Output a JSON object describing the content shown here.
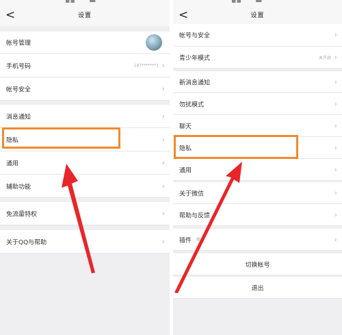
{
  "left": {
    "title": "设置",
    "back_icon": "chevron-left-icon",
    "rows": [
      {
        "label": "帐号管理",
        "trailing": "avatar"
      },
      {
        "label": "手机号码",
        "value": "187*******1"
      },
      {
        "label": "帐号安全"
      },
      {
        "label": "消息通知"
      },
      {
        "label": "隐私"
      },
      {
        "label": "通用"
      },
      {
        "label": "辅助功能"
      },
      {
        "label": "免流量特权"
      },
      {
        "label": "关于QQ与帮助"
      }
    ]
  },
  "right": {
    "title": "设置",
    "back_icon": "chevron-left-icon",
    "rows": [
      {
        "label": "帐号与安全"
      },
      {
        "label": "青少年模式",
        "value": "未开启"
      },
      {
        "label": "新消息通知"
      },
      {
        "label": "勿扰模式"
      },
      {
        "label": "聊天"
      },
      {
        "label": "隐私"
      },
      {
        "label": "通用"
      },
      {
        "label": "关于微信"
      },
      {
        "label": "帮助与反馈"
      },
      {
        "label": "插件"
      }
    ],
    "switch_account": "切换帐号",
    "logout": "退出"
  },
  "colors": {
    "highlight": "#f08a2c",
    "arrow": "#e8262a",
    "background": "#efeff2"
  }
}
